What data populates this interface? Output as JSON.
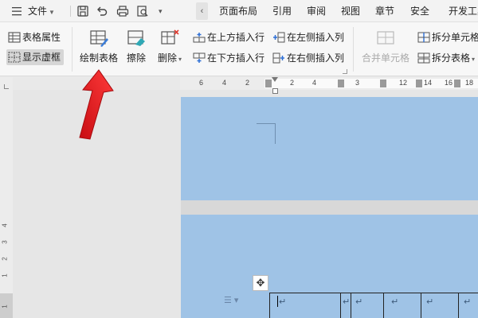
{
  "menubar": {
    "file_label": "文件",
    "tabs": [
      {
        "label": "页面布局"
      },
      {
        "label": "引用"
      },
      {
        "label": "审阅"
      },
      {
        "label": "视图"
      },
      {
        "label": "章节"
      },
      {
        "label": "安全"
      },
      {
        "label": "开发工具"
      }
    ]
  },
  "ribbon": {
    "table_properties": "表格属性",
    "show_gridlines": "显示虚框",
    "draw_table": "绘制表格",
    "erase": "擦除",
    "delete": "删除",
    "insert_row_above": "在上方插入行",
    "insert_row_below": "在下方插入行",
    "insert_col_left": "在左侧插入列",
    "insert_col_right": "在右侧插入列",
    "merge_cells": "合并单元格",
    "split_cells": "拆分单元格",
    "split_table": "拆分表格"
  },
  "hruler": {
    "labels": [
      "6",
      "4",
      "2",
      "2",
      "4",
      "3",
      "12",
      "14",
      "16",
      "18"
    ]
  },
  "vruler": {
    "labels": [
      "4",
      "3",
      "2",
      "1",
      "1"
    ]
  },
  "document": {
    "cell_marks": [
      "↵",
      "↵",
      "↵",
      "↵",
      "↵"
    ]
  },
  "colors": {
    "page_blue": "#9fc3e6",
    "arrow_red": "#e8141c",
    "ribbon_bg": "#f7f7f7"
  }
}
